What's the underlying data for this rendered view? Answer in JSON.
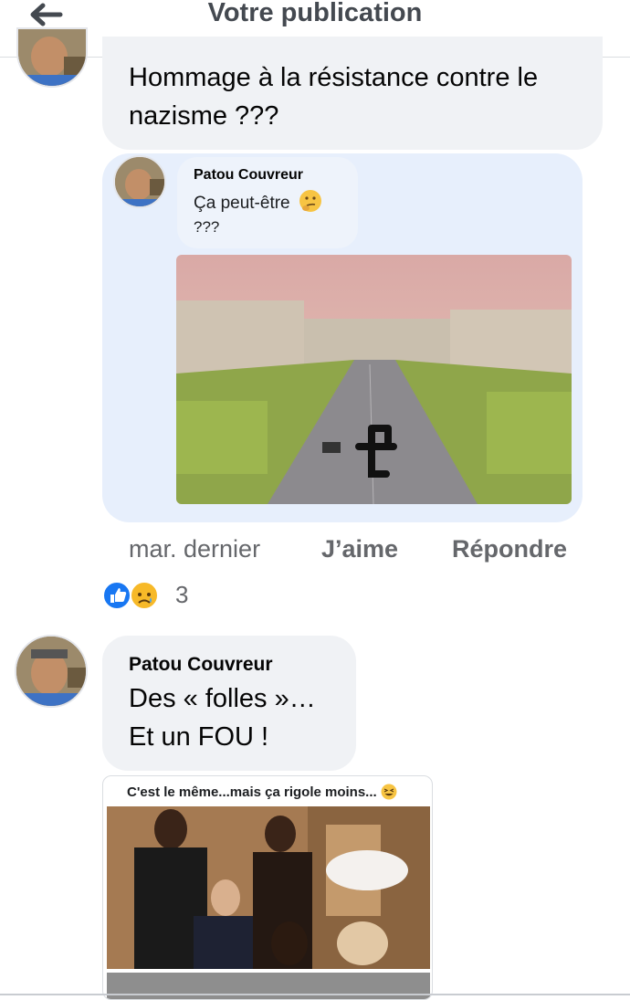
{
  "header": {
    "title": "Votre publication",
    "back_icon": "arrow-left-icon"
  },
  "comment1": {
    "text_line1": "Hommage à la résistance contre le",
    "text_line2": "nazisme ???"
  },
  "shared_comment": {
    "author": "Patou Couvreur",
    "text_line1": "Ça peut-être",
    "emoji_icon": "thinking-face-icon",
    "text_line2": "???"
  },
  "actions": {
    "time": "mar. dernier",
    "like": "J’aime",
    "reply": "Répondre"
  },
  "reactions": {
    "icons": [
      "like-icon",
      "sad-face-icon"
    ],
    "count": "3"
  },
  "comment2": {
    "author": "Patou Couvreur",
    "text_line1": "Des « folles »…",
    "text_line2": "Et un FOU !"
  },
  "shared_post": {
    "caption": "C'est le même...mais ça rigole moins...",
    "emoji_icon": "grinning-squint-icon"
  },
  "colors": {
    "bubble": "#f0f2f5",
    "like_blue": "#1877f2",
    "sad_yellow": "#f7b928",
    "header_text": "#444950"
  }
}
